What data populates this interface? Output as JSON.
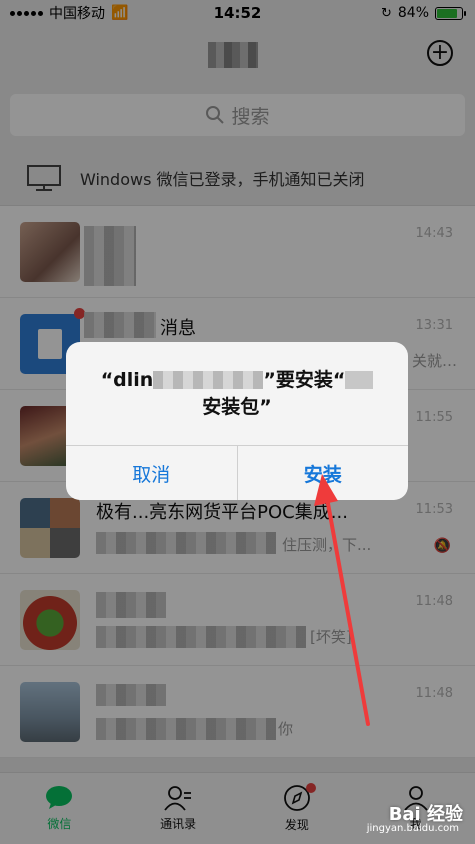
{
  "status_bar": {
    "carrier": "中国移动",
    "time": "14:52",
    "battery": "84%",
    "battery_level": 0.84
  },
  "search": {
    "label": "搜索"
  },
  "login_notice": {
    "text": "Windows 微信已登录，手机通知已关闭"
  },
  "chats": [
    {
      "name": "",
      "preview": "",
      "time": "14:43"
    },
    {
      "name": "消息",
      "preview": "关就…",
      "time": "13:31"
    },
    {
      "name": "",
      "preview": "",
      "time": "11:55"
    },
    {
      "name": "极有...亮东网货平台POC集成...",
      "preview": "住压测，下...",
      "time": "11:53"
    },
    {
      "name": "",
      "preview": "[坏笑]",
      "time": "11:48"
    },
    {
      "name": "",
      "preview": "你",
      "time": "11:48"
    }
  ],
  "tabs": [
    {
      "label": "微信",
      "icon": "chat-icon"
    },
    {
      "label": "通讯录",
      "icon": "contacts-icon"
    },
    {
      "label": "发现",
      "icon": "compass-icon"
    },
    {
      "label": "我",
      "icon": "profile-icon"
    }
  ],
  "dialog": {
    "line1_prefix": "“dlin",
    "line1_mid": "”要安装“",
    "line2": "安装包”",
    "cancel_label": "取消",
    "confirm_label": "安装"
  },
  "watermark": {
    "brand": "Bai 经验",
    "url": "jingyan.baidu.com"
  },
  "colors": {
    "accent_green": "#07c160",
    "dialog_blue": "#1677d9",
    "badge_red": "#e64340",
    "arrow_red": "#ef3b3b"
  }
}
